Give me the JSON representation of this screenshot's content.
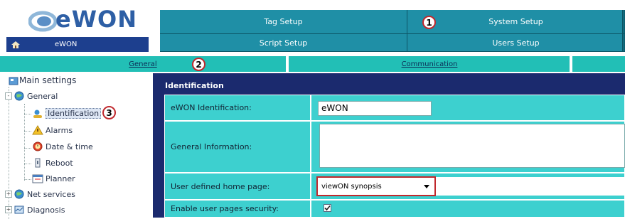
{
  "logo": {
    "text": "eWON"
  },
  "breadcrumb": {
    "label": "eWON"
  },
  "nav": [
    {
      "label": "Tag Setup"
    },
    {
      "label": "System Setup"
    },
    {
      "label": "Script Setup"
    },
    {
      "label": "Users Setup"
    }
  ],
  "subtabs": [
    {
      "label": "General"
    },
    {
      "label": "Communication"
    }
  ],
  "callouts": [
    "1",
    "2",
    "3"
  ],
  "tree": {
    "root": "Main settings",
    "general": "General",
    "children": [
      "Identification",
      "Alarms",
      "Date & time",
      "Reboot",
      "Planner"
    ],
    "net_services": "Net services",
    "diagnosis": "Diagnosis"
  },
  "panel": {
    "title": "Identification",
    "rows": {
      "identification_label": "eWON Identification:",
      "identification_value": "eWON",
      "general_info_label": "General Information:",
      "home_page_label": "User defined home page:",
      "home_page_value": "viewON synopsis",
      "security_label": "Enable user pages security:"
    }
  }
}
